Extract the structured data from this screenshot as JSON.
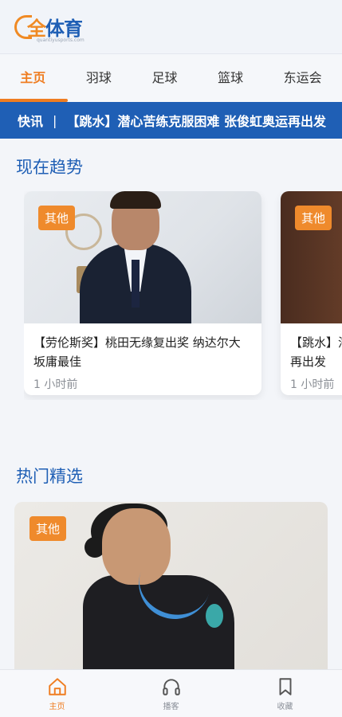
{
  "header": {
    "logo_text_1": "全",
    "logo_text_2": "体育",
    "logo_sub": "quantiyusports.com"
  },
  "tabs": [
    {
      "label": "主页",
      "active": true
    },
    {
      "label": "羽球",
      "active": false
    },
    {
      "label": "足球",
      "active": false
    },
    {
      "label": "篮球",
      "active": false
    },
    {
      "label": "东运会",
      "active": false
    }
  ],
  "ticker": {
    "label": "快讯",
    "separator": "|",
    "headline": "【跳水】潜心苦练克服困难 张俊虹奥运再出发"
  },
  "trending": {
    "title": "现在趋势",
    "cards": [
      {
        "badge": "其他",
        "title": "【劳伦斯奖】桃田无缘复出奖 纳达尔大坂庸最佳",
        "time": "1 小时前"
      },
      {
        "badge": "其他",
        "title": "【跳水】潜心苦练克服困难 张俊虹奥运再出发",
        "time": "1 小时前"
      }
    ]
  },
  "hot": {
    "title": "热门精选",
    "card": {
      "badge": "其他"
    }
  },
  "bottom_nav": [
    {
      "label": "主页",
      "icon": "home-icon",
      "active": true
    },
    {
      "label": "播客",
      "icon": "headphones-icon",
      "active": false
    },
    {
      "label": "收藏",
      "icon": "bookmark-icon",
      "active": false
    }
  ],
  "colors": {
    "accent": "#ef7d21",
    "brand_blue": "#1f5fb5"
  }
}
